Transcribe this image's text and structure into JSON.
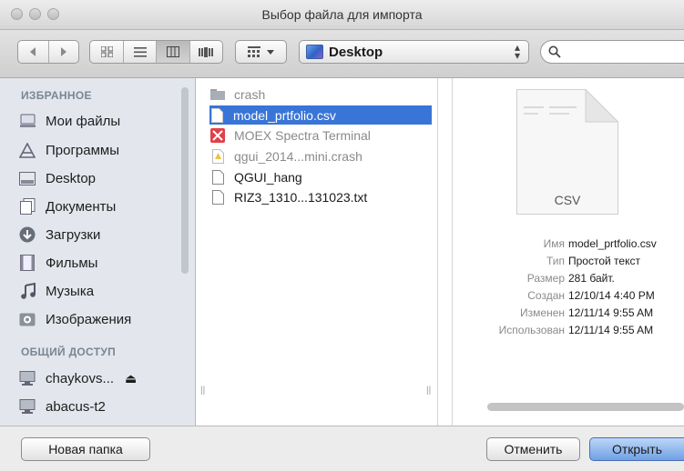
{
  "window": {
    "title": "Выбор файла для импорта"
  },
  "toolbar": {
    "location": "Desktop",
    "search_placeholder": "",
    "view_mode": "columns"
  },
  "sidebar": {
    "favorites_header": "ИЗБРАННОЕ",
    "favorites": [
      {
        "label": "Мои файлы",
        "icon": "all-files-icon"
      },
      {
        "label": "Программы",
        "icon": "applications-icon"
      },
      {
        "label": "Desktop",
        "icon": "desktop-icon"
      },
      {
        "label": "Документы",
        "icon": "documents-icon"
      },
      {
        "label": "Загрузки",
        "icon": "downloads-icon"
      },
      {
        "label": "Фильмы",
        "icon": "movies-icon"
      },
      {
        "label": "Музыка",
        "icon": "music-icon"
      },
      {
        "label": "Изображения",
        "icon": "pictures-icon"
      }
    ],
    "shared_header": "ОБЩИЙ ДОСТУП",
    "shared": [
      {
        "label": "chaykovs...",
        "icon": "computer-icon"
      },
      {
        "label": "abacus-t2",
        "icon": "computer-icon"
      }
    ],
    "eject_glyph": "⏏"
  },
  "files": [
    {
      "name": "crash",
      "icon": "folder-icon",
      "state": "dim"
    },
    {
      "name": "model_prtfolio.csv",
      "icon": "document-icon",
      "state": "selected"
    },
    {
      "name": "MOEX Spectra Terminal",
      "icon": "app-icon",
      "state": "dim"
    },
    {
      "name": "qgui_2014...mini.crash",
      "icon": "crash-log-icon",
      "state": "dim"
    },
    {
      "name": "QGUI_hang",
      "icon": "document-icon",
      "state": "normal"
    },
    {
      "name": "RIZ3_1310...131023.txt",
      "icon": "document-icon",
      "state": "normal"
    }
  ],
  "preview": {
    "type_label": "CSV",
    "info": [
      {
        "key": "Имя",
        "value": "model_prtfolio.csv"
      },
      {
        "key": "Тип",
        "value": "Простой текст"
      },
      {
        "key": "Размер",
        "value": "281 байт."
      },
      {
        "key": "Создан",
        "value": "12/10/14 4:40 PM"
      },
      {
        "key": "Изменен",
        "value": "12/11/14 9:55 AM"
      },
      {
        "key": "Использован",
        "value": "12/11/14 9:55 AM"
      }
    ]
  },
  "buttons": {
    "new_folder": "Новая папка",
    "cancel": "Отменить",
    "open": "Открыть"
  }
}
